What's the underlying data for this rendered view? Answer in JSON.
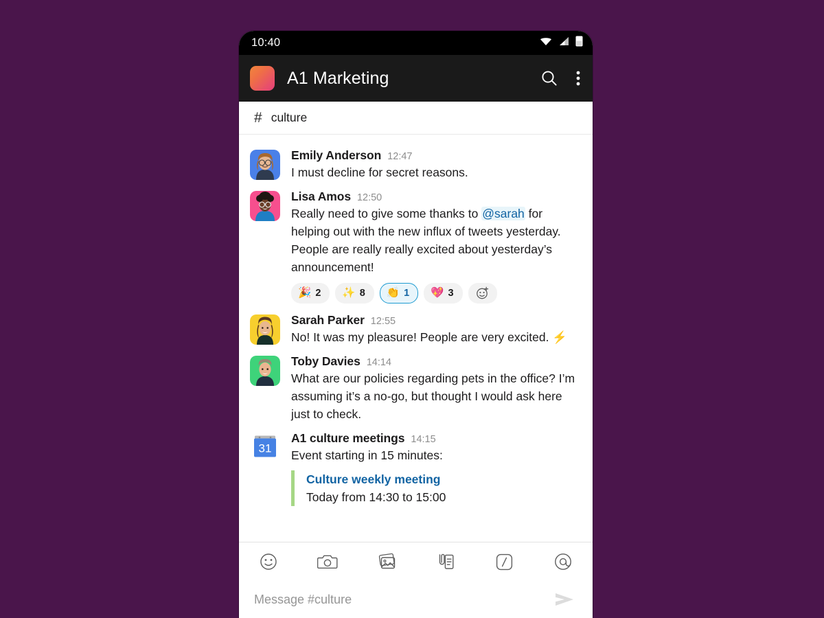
{
  "status_bar": {
    "time": "10:40",
    "icons": [
      "wifi-icon",
      "cellular-signal-icon",
      "battery-icon"
    ]
  },
  "app_bar": {
    "workspace_logo": "workspace-logo",
    "workspace_name": "A1 Marketing",
    "search_icon": "search-icon",
    "overflow_icon": "more-vertical-icon"
  },
  "channel_bar": {
    "hash": "#",
    "channel_name": "culture"
  },
  "messages": [
    {
      "author": "Emily Anderson",
      "time": "12:47",
      "text": "I must decline for secret reasons.",
      "avatar_color": "#4a80e8",
      "avatar_name": "avatar-emily-anderson"
    },
    {
      "author": "Lisa Amos",
      "time": "12:50",
      "text_pre": "Really need to give some thanks to ",
      "mention": "@sarah",
      "text_post": " for helping out with the new influx of tweets yesterday. People are really really excited about yesterday’s announcement!",
      "avatar_color": "#f74f8e",
      "avatar_name": "avatar-lisa-amos",
      "reactions": [
        {
          "emoji": "🎉",
          "count": "2",
          "name": "reaction-tada",
          "selected": false
        },
        {
          "emoji": "✨",
          "count": "8",
          "name": "reaction-sparkles",
          "selected": false
        },
        {
          "emoji": "👏",
          "count": "1",
          "name": "reaction-clap",
          "selected": true
        },
        {
          "emoji": "💖",
          "count": "3",
          "name": "reaction-sparkling-heart",
          "selected": false
        }
      ],
      "add_reaction": "add-reaction-button"
    },
    {
      "author": "Sarah Parker",
      "time": "12:55",
      "text": "No! It was my pleasure! People are very excited. ⚡",
      "avatar_color": "#f7cf2e",
      "avatar_name": "avatar-sarah-parker"
    },
    {
      "author": "Toby Davies",
      "time": "14:14",
      "text": "What are our policies regarding pets in the office? I’m assuming it’s a no-go, but thought I would ask here just to check.",
      "avatar_color": "#3ed37a",
      "avatar_name": "avatar-toby-davies"
    },
    {
      "author": "A1 culture meetings",
      "time": "14:15",
      "text": "Event starting in 15 minutes:",
      "avatar_name": "google-calendar-icon",
      "calendar_day": "31",
      "attachment": {
        "title": "Culture weekly meeting",
        "subtitle": "Today from 14:30 to 15:00",
        "bar_color": "#a6d785"
      }
    }
  ],
  "composer": {
    "tools": [
      "emoji-icon",
      "camera-icon",
      "photos-icon",
      "attachment-icon",
      "slash-command-icon",
      "mention-icon"
    ],
    "placeholder": "Message #culture",
    "value": "",
    "send_icon": "send-icon"
  },
  "theme": {
    "background": "#4a154b",
    "appbar": "#1a1a1a",
    "statusbar": "#000000",
    "mention_color": "#1264a3",
    "link_color": "#1264a3",
    "selected_reaction_border": "#1d9bd1"
  }
}
